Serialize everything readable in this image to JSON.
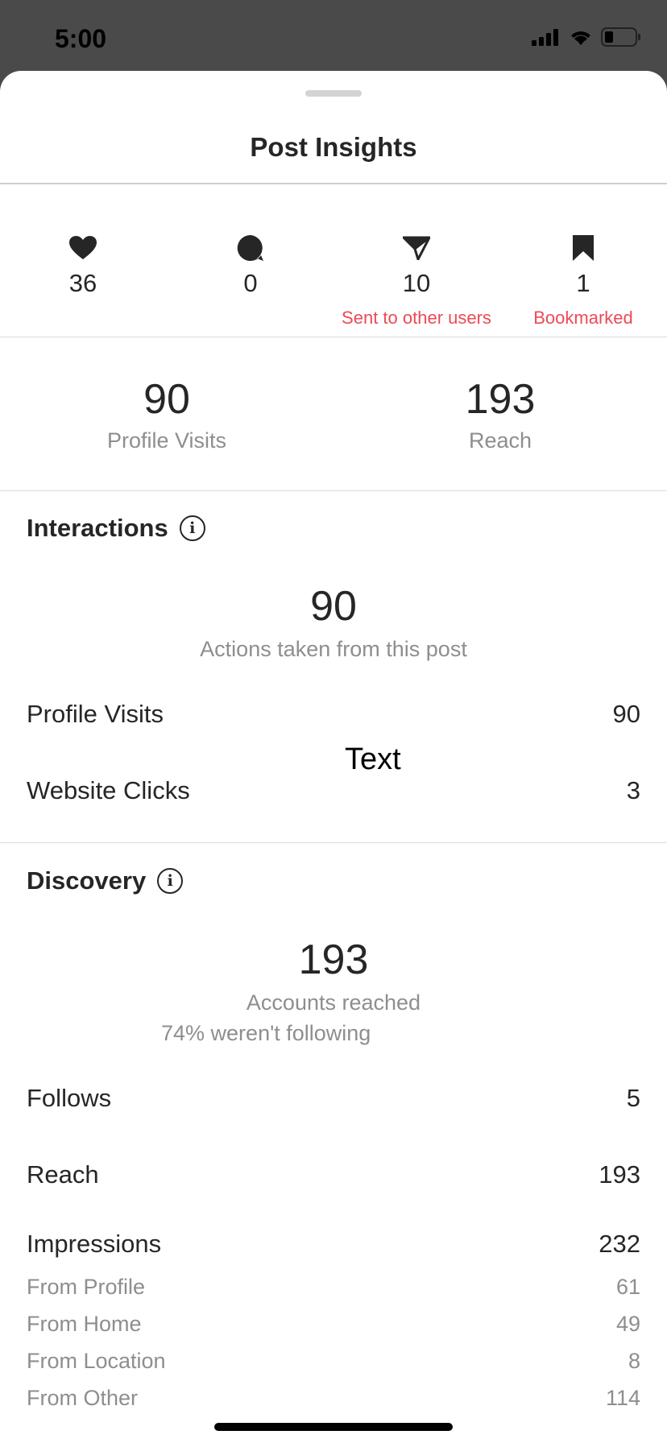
{
  "status_bar": {
    "time": "5:00"
  },
  "sheet": {
    "title": "Post Insights"
  },
  "metrics": [
    {
      "icon": "heart-icon",
      "value": "36",
      "label": ""
    },
    {
      "icon": "comment-icon",
      "value": "0",
      "label": ""
    },
    {
      "icon": "send-icon",
      "value": "10",
      "label": "Sent to other users"
    },
    {
      "icon": "bookmark-icon",
      "value": "1",
      "label": "Bookmarked"
    }
  ],
  "summary": {
    "profile_visits": {
      "value": "90",
      "label": "Profile Visits"
    },
    "reach": {
      "value": "193",
      "label": "Reach"
    }
  },
  "interactions": {
    "title": "Interactions",
    "total": "90",
    "total_label": "Actions taken from this post",
    "rows": [
      {
        "label": "Profile Visits",
        "value": "90"
      },
      {
        "label": "Website Clicks",
        "value": "3"
      }
    ],
    "overlay_text": "Text"
  },
  "discovery": {
    "title": "Discovery",
    "total": "193",
    "total_label": "Accounts reached",
    "note": "74% weren't following",
    "rows": [
      {
        "label": "Follows",
        "value": "5"
      },
      {
        "label": "Reach",
        "value": "193"
      },
      {
        "label": "Impressions",
        "value": "232"
      }
    ],
    "sub_rows": [
      {
        "label": "From Profile",
        "value": "61"
      },
      {
        "label": "From Home",
        "value": "49"
      },
      {
        "label": "From Location",
        "value": "8"
      },
      {
        "label": "From Other",
        "value": "114"
      }
    ]
  },
  "colors": {
    "accent_red": "#ed4956",
    "text": "#262626",
    "muted": "#8e8e8e"
  }
}
